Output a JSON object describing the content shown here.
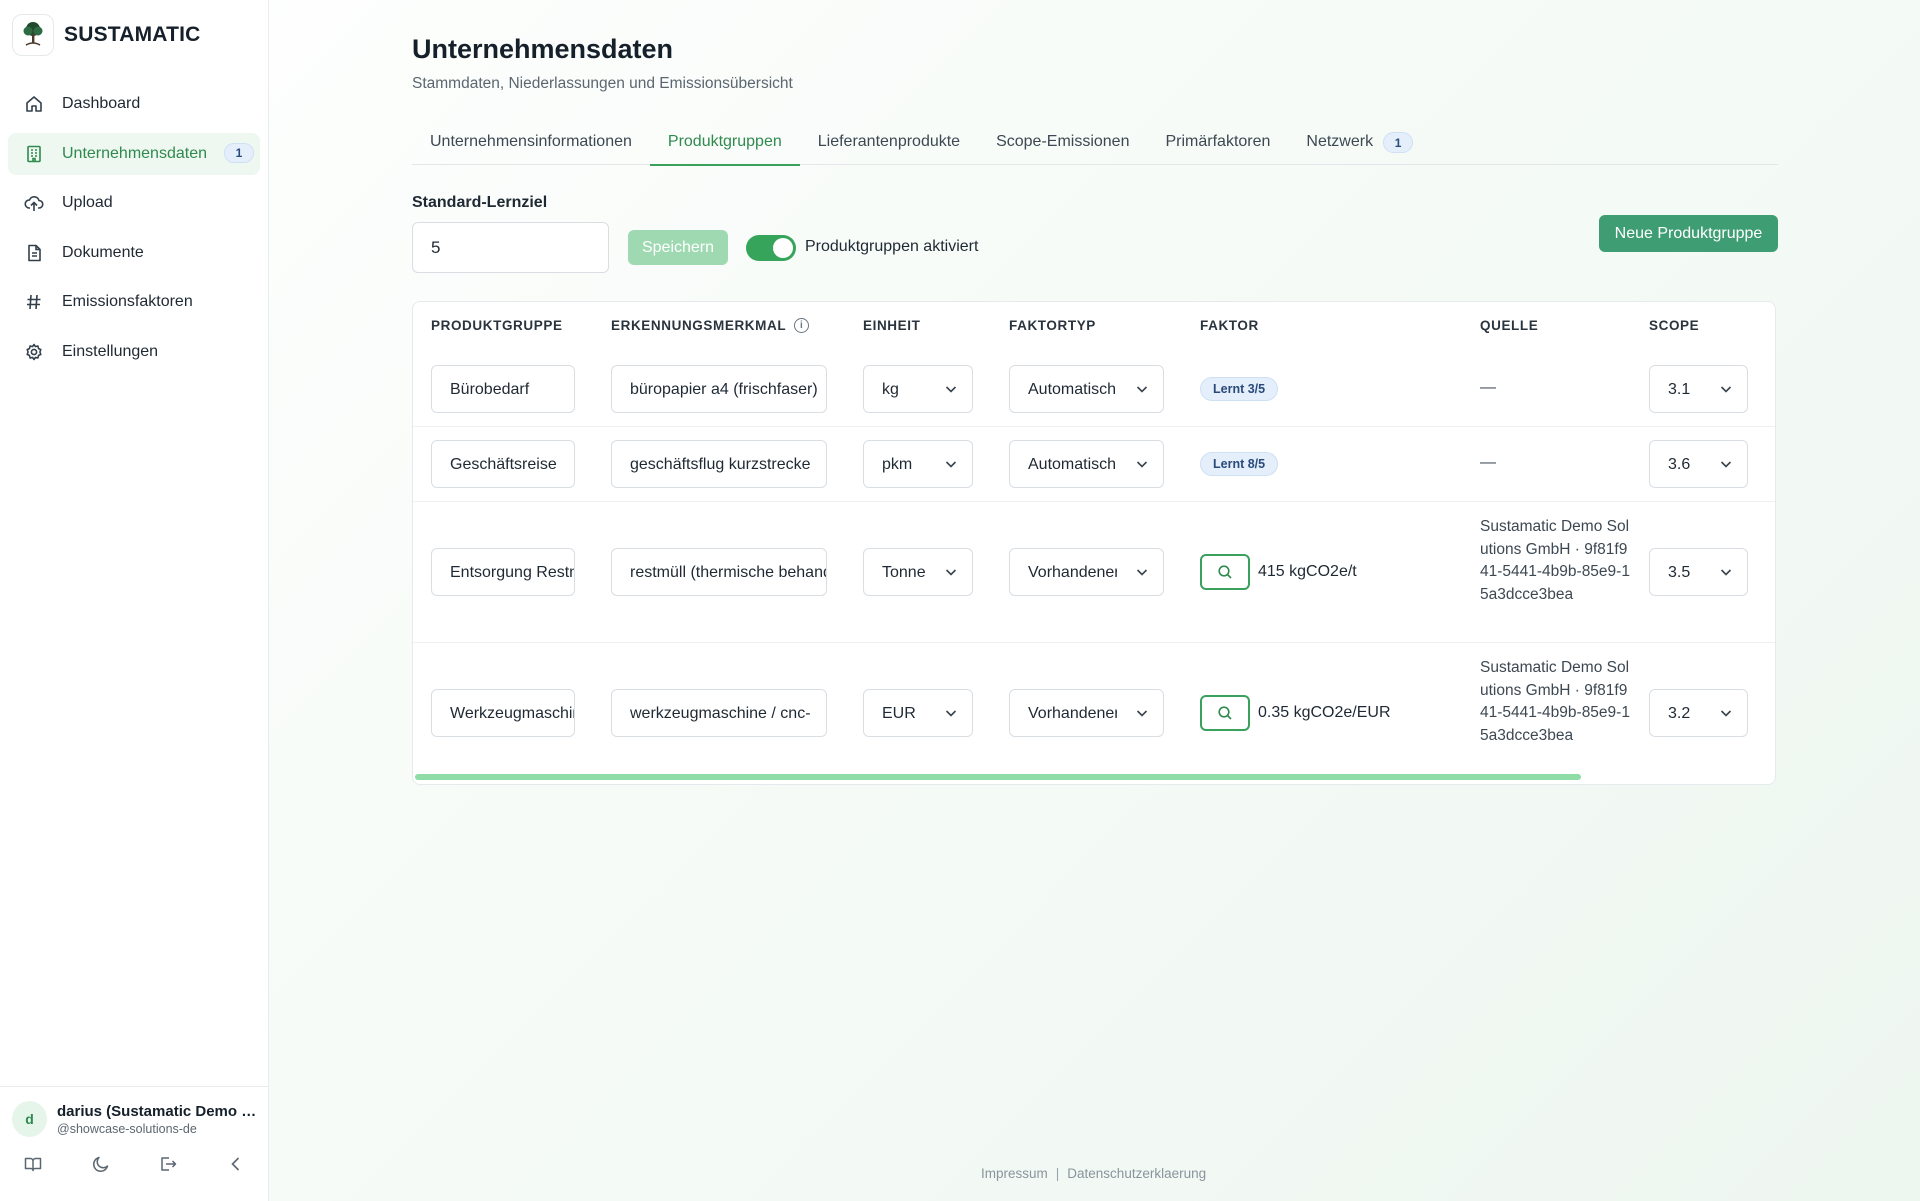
{
  "brand": {
    "name": "SUSTAMATIC"
  },
  "sidebar": {
    "items": [
      {
        "label": "Dashboard",
        "icon": "home-icon",
        "active": false
      },
      {
        "label": "Unternehmensdaten",
        "icon": "building-icon",
        "active": true,
        "badge": "1"
      },
      {
        "label": "Upload",
        "icon": "cloud-upload-icon",
        "active": false
      },
      {
        "label": "Dokumente",
        "icon": "document-icon",
        "active": false
      },
      {
        "label": "Emissionsfaktoren",
        "icon": "hash-icon",
        "active": false
      },
      {
        "label": "Einstellungen",
        "icon": "gear-icon",
        "active": false
      }
    ]
  },
  "user": {
    "initial": "d",
    "name": "darius (Sustamatic Demo Solutions GmbH)",
    "handle": "@showcase-solutions-de"
  },
  "page": {
    "title": "Unternehmensdaten",
    "subtitle": "Stammdaten, Niederlassungen und Emissionsübersicht"
  },
  "tabs": [
    {
      "label": "Unternehmensinformationen",
      "active": false
    },
    {
      "label": "Produktgruppen",
      "active": true
    },
    {
      "label": "Lieferantenprodukte",
      "active": false
    },
    {
      "label": "Scope-Emissionen",
      "active": false
    },
    {
      "label": "Primärfaktoren",
      "active": false
    },
    {
      "label": "Netzwerk",
      "active": false,
      "badge": "1"
    }
  ],
  "settings": {
    "lernziel_label": "Standard-Lernziel",
    "lernziel_value": "5",
    "save_label": "Speichern",
    "toggle_label": "Produktgruppen aktiviert",
    "toggle_on": true,
    "new_button_label": "Neue Produktgruppe"
  },
  "table": {
    "headers": {
      "produktgruppe": "PRODUKTGRUPPE",
      "erkennungsmerkmal": "ERKENNUNGSMERKMAL",
      "einheit": "EINHEIT",
      "faktortyp": "FAKTORTYP",
      "faktor": "FAKTOR",
      "quelle": "QUELLE",
      "scope": "SCOPE"
    },
    "rows": [
      {
        "produktgruppe": "Bürobedarf",
        "erkennungsmerkmal": "büropapier a4 (frischfaser)",
        "einheit": "kg",
        "faktortyp": "Automatisch",
        "faktor_badge": "Lernt 3/5",
        "quelle": "—",
        "scope": "3.1"
      },
      {
        "produktgruppe": "Geschäftsreise",
        "erkennungsmerkmal": "geschäftsflug kurzstrecke",
        "einheit": "pkm",
        "faktortyp": "Automatisch",
        "faktor_badge": "Lernt 8/5",
        "quelle": "—",
        "scope": "3.6"
      },
      {
        "produktgruppe": "Entsorgung Restmüll",
        "erkennungsmerkmal": "restmüll (thermische behandlung)",
        "einheit": "Tonne",
        "faktortyp": "Vorhandener",
        "faktor_value": "415 kgCO2e/t",
        "quelle": "Sustamatic Demo Solutions GmbH · 9f81f941-5441-4b9b-85e9-15a3dcce3bea",
        "scope": "3.5"
      },
      {
        "produktgruppe": "Werkzeugmaschinen",
        "erkennungsmerkmal": "werkzeugmaschine / cnc-",
        "einheit": "EUR",
        "faktortyp": "Vorhandener",
        "faktor_value": "0.35 kgCO2e/EUR",
        "quelle": "Sustamatic Demo Solutions GmbH · 9f81f941-5441-4b9b-85e9-15a3dcce3bea",
        "scope": "3.2"
      }
    ]
  },
  "footer": {
    "impressum": "Impressum",
    "separator": "|",
    "datenschutz": "Datenschutzerklaerung"
  },
  "colors": {
    "accent": "#3aa15d",
    "primary_button": "#3f9d74",
    "badge_bg": "#e4effb"
  }
}
